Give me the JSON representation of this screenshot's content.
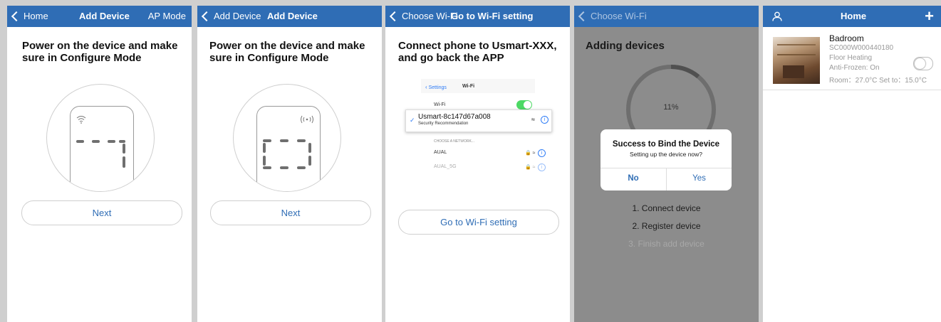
{
  "panel1": {
    "nav": {
      "back": "Home",
      "title": "Add Device",
      "right": "AP Mode"
    },
    "heading": "Power on the device and make sure in Configure Mode",
    "button": "Next"
  },
  "panel2": {
    "nav": {
      "back": "Add Device",
      "title": "Add Device"
    },
    "heading": "Power on the device and make sure in Configure Mode",
    "button": "Next"
  },
  "panel3": {
    "nav": {
      "back": "Choose Wi-Fi",
      "title": "Go to Wi-Fi setting"
    },
    "heading": "Connect phone to Usmart-XXX, and go back the APP",
    "mock": {
      "settings_back": "Settings",
      "title": "Wi-Fi",
      "wifi_label": "Wi-Fi",
      "network_name": "Usmart-8c147d67a008",
      "network_sub": "Security Recommendation",
      "choose_label": "CHOOSE A NETWORK...",
      "other1": "AUAL",
      "other2": "AUAL_5G"
    },
    "button": "Go to Wi-Fi setting"
  },
  "panel4": {
    "nav": {
      "back": "Choose Wi-Fi"
    },
    "heading": "Adding devices",
    "progress": {
      "value": 11,
      "label": "11%"
    },
    "dialog": {
      "title": "Success to Bind the Device",
      "message": "Setting up the device now?",
      "no": "No",
      "yes": "Yes"
    },
    "steps": [
      "1. Connect device",
      "2. Register device",
      "3. Finish add device"
    ]
  },
  "panel5": {
    "nav": {
      "title": "Home",
      "left_icon": "user-icon",
      "right_icon": "plus-icon"
    },
    "device": {
      "name": "Badroom",
      "id": "SC000W000440180",
      "type": "Floor Heating",
      "anti": "Anti-Frozen: On",
      "room": "Room：27.0°C Set to：15.0°C",
      "power": false
    }
  },
  "colors": {
    "nav": "#2f6db5",
    "accent": "#2f6db5",
    "overlay": "#8c8c8c"
  }
}
